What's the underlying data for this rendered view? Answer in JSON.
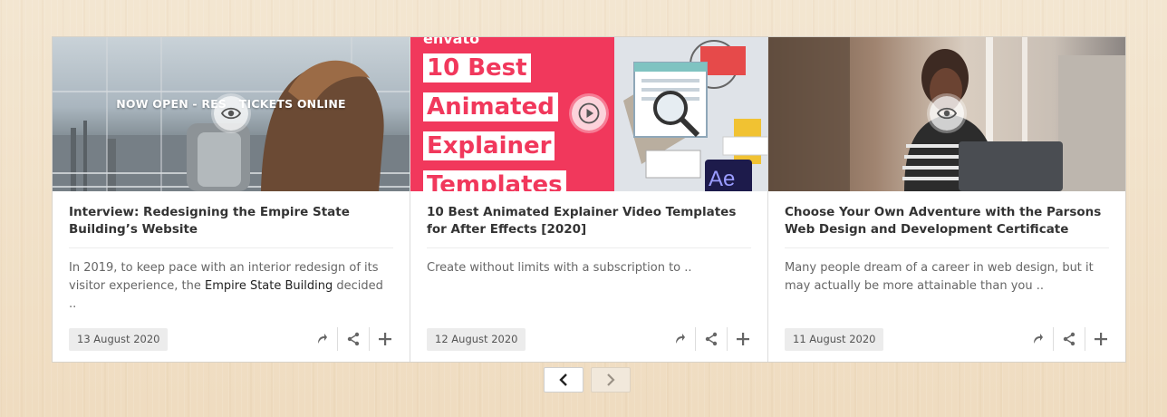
{
  "cards": [
    {
      "overlay_text": "NOW OPEN - RES   TICKETS ONLINE",
      "title": "Interview: Redesigning the Empire State Building’s Website",
      "excerpt_before": "In 2019, to keep pace with an interior redesign of its visitor experience, the ",
      "excerpt_link": "Empire State Building",
      "excerpt_after": " decided ..",
      "date": "13 August 2020",
      "thumb_icon": "eye-icon"
    },
    {
      "brand": "envato",
      "banner_lines": [
        "10 Best",
        "Animated",
        "Explainer",
        "Templates"
      ],
      "badge": "Ae",
      "title": "10 Best Animated Explainer Video Templates for After Effects [2020]",
      "excerpt": "Create without limits with a subscription to ..",
      "date": "12 August 2020",
      "thumb_icon": "play-icon"
    },
    {
      "title": "Choose Your Own Adventure with the Parsons Web Design and Development Certificate",
      "excerpt": "Many people dream of a career in web design, but it may actually be more attainable than you ..",
      "date": "11 August 2020",
      "thumb_icon": "eye-icon"
    }
  ],
  "actions": [
    "open-link-icon",
    "share-icon",
    "plus-icon"
  ],
  "pagination": {
    "prev_icon": "chevron-left-icon",
    "next_icon": "chevron-right-icon",
    "next_disabled": true
  },
  "colors": {
    "banner_red": "#f1385c",
    "text": "#333333",
    "date_bg": "#ececec"
  }
}
